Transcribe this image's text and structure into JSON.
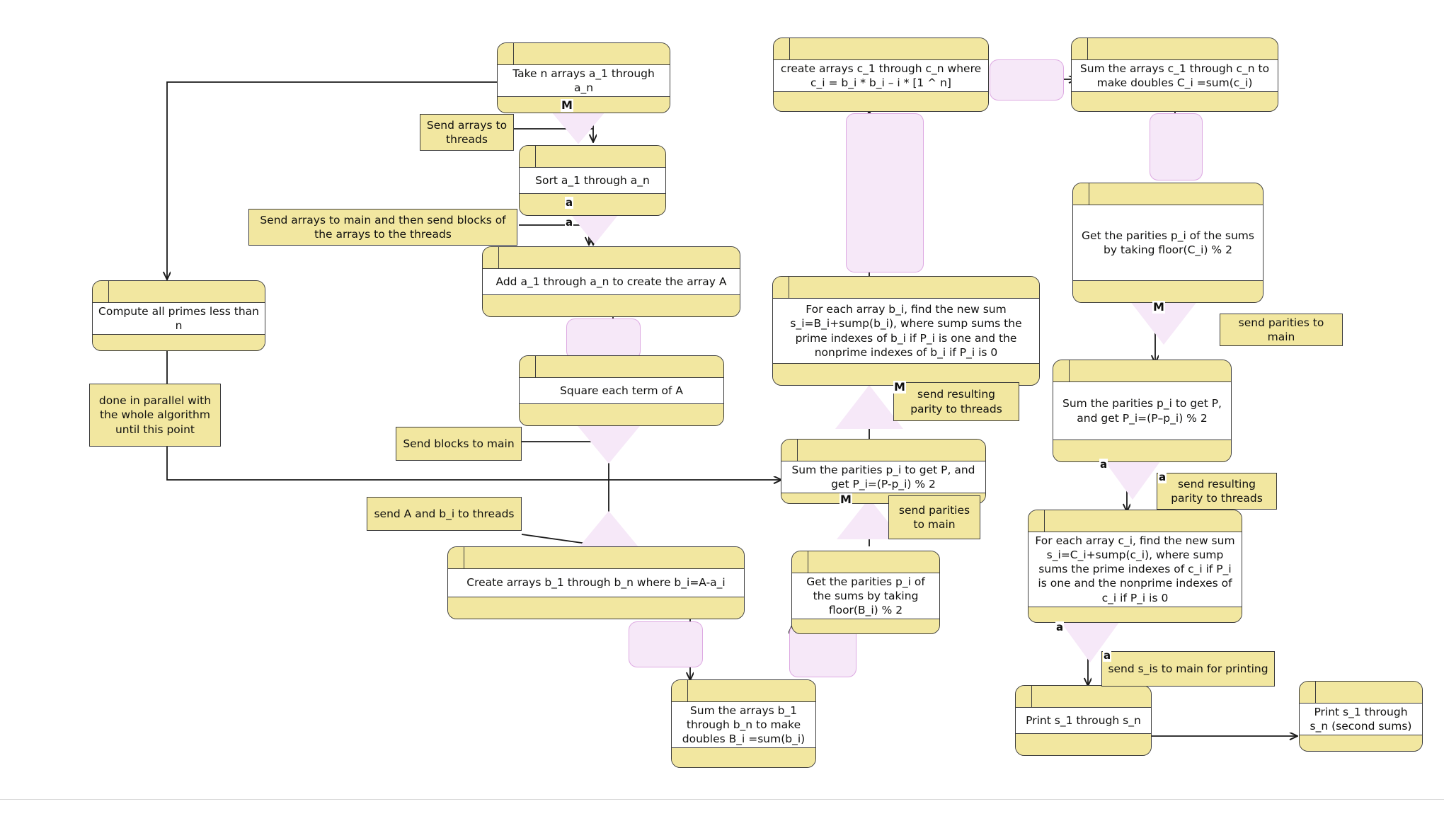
{
  "diagram": {
    "title": "Parallel array summation algorithm activity diagram",
    "colors": {
      "node_band": "#f2e7a0",
      "node_body": "#ffffff",
      "node_border": "#3c3c3c",
      "connector_fill": "#f6e8f8",
      "connector_border": "#dda9e2",
      "edge": "#1a1a1a"
    }
  },
  "nodes": [
    {
      "id": "take_n_arrays",
      "text": "Take n arrays a_1 through a_n"
    },
    {
      "id": "sort_arrays",
      "text": "Sort a_1 through a_n"
    },
    {
      "id": "add_arrays",
      "text": "Add a_1 through a_n to create the array A"
    },
    {
      "id": "square_terms",
      "text": "Square each term of A"
    },
    {
      "id": "create_b",
      "text": "Create arrays b_1 through b_n where b_i=A-a_i"
    },
    {
      "id": "sum_b",
      "text": "Sum the arrays b_1 through b_n to make doubles B_i =sum(b_i)"
    },
    {
      "id": "compute_primes",
      "text": "Compute all primes less than n"
    },
    {
      "id": "parities_b",
      "text": "Get the parities p_i of the sums by taking floor(B_i) % 2"
    },
    {
      "id": "sum_parities_b",
      "text": "Sum the parities p_i to get P, and get P_i=(P-p_i) % 2"
    },
    {
      "id": "new_sum_b",
      "text": "For each array b_i, find the new sum s_i=B_i+sump(b_i), where sump sums the prime indexes of b_i if P_i is one and the nonprime indexes of b_i if P_i is 0"
    },
    {
      "id": "create_c",
      "text": "create arrays c_1 through c_n where c_i = b_i * b_i –  i * [1 ^ n]"
    },
    {
      "id": "sum_c",
      "text": "Sum the arrays c_1 through c_n to make doubles C_i =sum(c_i)"
    },
    {
      "id": "parities_c",
      "text": "Get the parities p_i of the sums by taking floor(C_i) % 2"
    },
    {
      "id": "sum_parities_c",
      "text": "Sum the parities p_i to get P, and get P_i=(P–p_i) % 2"
    },
    {
      "id": "new_sum_c",
      "text": "For each array c_i, find the new sum s_i=C_i+sump(c_i), where sump sums the prime indexes of c_i if P_i is one and the nonprime indexes of c_i if P_i is 0"
    },
    {
      "id": "print_s",
      "text": "Print s_1 through s_n"
    },
    {
      "id": "print_s_second",
      "text": "Print s_1 through s_n (second sums)"
    }
  ],
  "notes": [
    {
      "id": "note_send_arrays_threads",
      "text": "Send arrays to threads"
    },
    {
      "id": "note_send_arrays_main",
      "text": "Send arrays to main and then send blocks of the arrays to the threads"
    },
    {
      "id": "note_done_parallel",
      "text": "done in parallel with the whole algorithm until this point"
    },
    {
      "id": "note_send_blocks_main",
      "text": "Send blocks to main"
    },
    {
      "id": "note_send_a_b",
      "text": "send A and b_i to threads"
    },
    {
      "id": "note_send_parities_main_1",
      "text": "send parities to main"
    },
    {
      "id": "note_send_parity_threads_1",
      "text": "send resulting parity to threads"
    },
    {
      "id": "note_send_parities_main_2",
      "text": "send parities to main"
    },
    {
      "id": "note_send_parity_threads_2",
      "text": "send resulting parity to threads"
    },
    {
      "id": "note_send_sis_print",
      "text": "send s_is to main for printing"
    }
  ],
  "markers": [
    {
      "id": "m_take_n",
      "label": "M"
    },
    {
      "id": "a_sort_top",
      "label": "a"
    },
    {
      "id": "a_sort_bot",
      "label": "a"
    },
    {
      "id": "m_new_sum_b",
      "label": "M"
    },
    {
      "id": "m_sum_parities_b",
      "label": "M"
    },
    {
      "id": "m_parities_c",
      "label": "M"
    },
    {
      "id": "a_sum_parities_c",
      "label": "a"
    },
    {
      "id": "a_note_parity_c",
      "label": "a"
    },
    {
      "id": "a_new_sum_c",
      "label": "a"
    },
    {
      "id": "a_note_print",
      "label": "a"
    }
  ]
}
